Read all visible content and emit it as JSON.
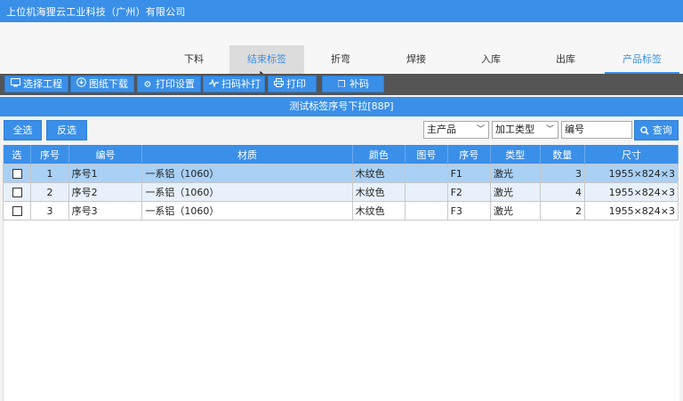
{
  "window": {
    "title": "上位机海狸云工业科技（广州）有限公司"
  },
  "nav": {
    "tabs": [
      "下料",
      "结束标签",
      "折弯",
      "焊接",
      "入库",
      "出库",
      "产品标签"
    ],
    "active_index": 1,
    "underlined_index": 6
  },
  "toolbar": {
    "select_project": "选择工程",
    "download_drawing": "图纸下载",
    "print_settings": "打印设置",
    "scan_reprint": "扫码补打",
    "print": "打印",
    "reprint_code": "补码"
  },
  "subtitle": "测试标签序号下拉[88P]",
  "filter": {
    "select_all": "全选",
    "invert": "反选",
    "product_type": "主产品",
    "process_type": "加工类型",
    "code_placeholder": "编号",
    "query": "查询"
  },
  "table": {
    "headers": [
      "选",
      "序号",
      "编号",
      "材质",
      "颜色",
      "图号",
      "序号",
      "类型",
      "数量",
      "尺寸"
    ],
    "rows": [
      {
        "seq": "1",
        "code": "序号1",
        "material": "一系铝（1060）",
        "color": "木纹色",
        "drawing": "",
        "no": "F1",
        "type": "激光",
        "qty": "3",
        "size": "1955×824×3"
      },
      {
        "seq": "2",
        "code": "序号2",
        "material": "一系铝（1060）",
        "color": "木纹色",
        "drawing": "",
        "no": "F2",
        "type": "激光",
        "qty": "4",
        "size": "1955×824×3"
      },
      {
        "seq": "3",
        "code": "序号3",
        "material": "一系铝（1060）",
        "color": "木纹色",
        "drawing": "",
        "no": "F3",
        "type": "激光",
        "qty": "2",
        "size": "1955×824×3"
      }
    ]
  },
  "colors": {
    "accent": "#3a8fe8",
    "toolbar_bg": "#555555",
    "selected_row": "#a9d0f5"
  }
}
